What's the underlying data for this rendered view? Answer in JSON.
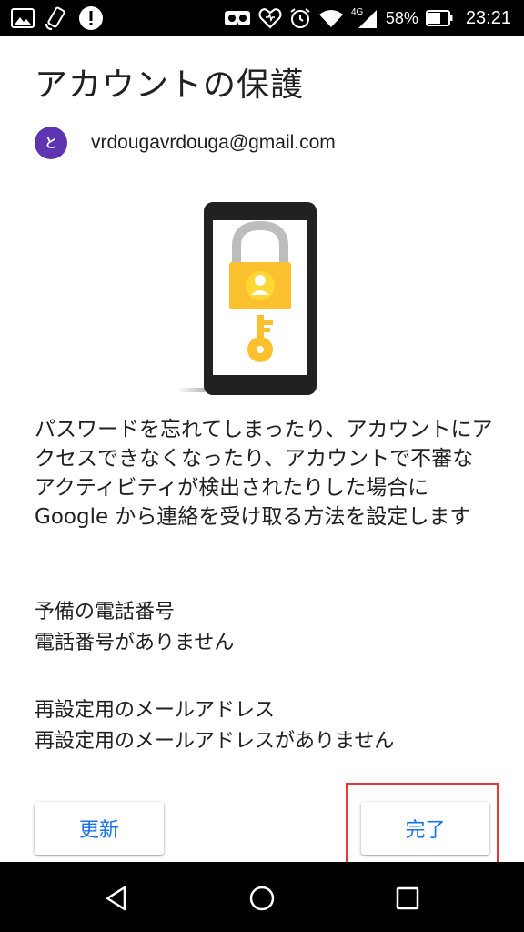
{
  "status_bar": {
    "network": "4G",
    "battery": "58%",
    "time": "23:21",
    "icons_left": [
      "image-icon",
      "rotate-icon",
      "alert-icon"
    ],
    "icons_right": [
      "vr-icon",
      "heart-icon",
      "alarm-icon",
      "wifi-icon",
      "signal-icon",
      "battery-icon"
    ]
  },
  "page": {
    "title": "アカウントの保護",
    "account": {
      "avatar_letter": "と",
      "avatar_color": "#5e35b1",
      "email": "vrdougavrdouga@gmail.com"
    },
    "description": "パスワードを忘れてしまったり、アカウントにアクセスできなくなったり、アカウントで不審なアクティビティが検出されたりした場合に Google から連絡を受け取る方法を設定します",
    "recovery_phone": {
      "label": "予備の電話番号",
      "value": "電話番号がありません"
    },
    "recovery_email": {
      "label": "再設定用のメールアドレス",
      "value": "再設定用のメールアドレスがありません"
    }
  },
  "buttons": {
    "update": "更新",
    "done": "完了"
  },
  "colors": {
    "accent": "#1a73e8",
    "highlight": "#e53935",
    "lock_yellow": "#fbc02d"
  }
}
